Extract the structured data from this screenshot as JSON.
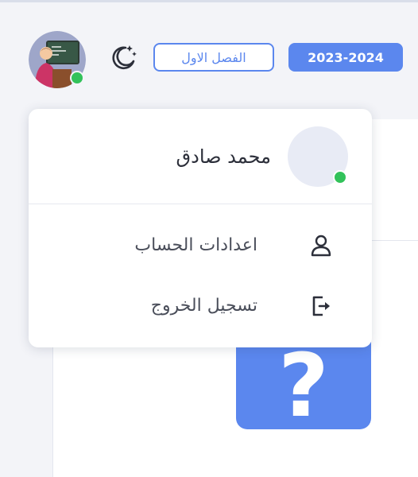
{
  "header": {
    "academic_year": "2023-2024",
    "semester": "الفصل الاول",
    "theme_icon": "moon-stars-icon",
    "avatar_icon": "teacher-avatar-icon"
  },
  "user_menu": {
    "user_name": "محمد صادق",
    "items": [
      {
        "label": "اعدادات الحساب",
        "icon": "user-icon"
      },
      {
        "label": "تسجيل الخروج",
        "icon": "logout-icon"
      }
    ]
  },
  "background_card": {
    "help_symbol": "?"
  },
  "colors": {
    "accent": "#5b87ee",
    "online": "#32c25a",
    "page_background": "#f3f4f8"
  }
}
